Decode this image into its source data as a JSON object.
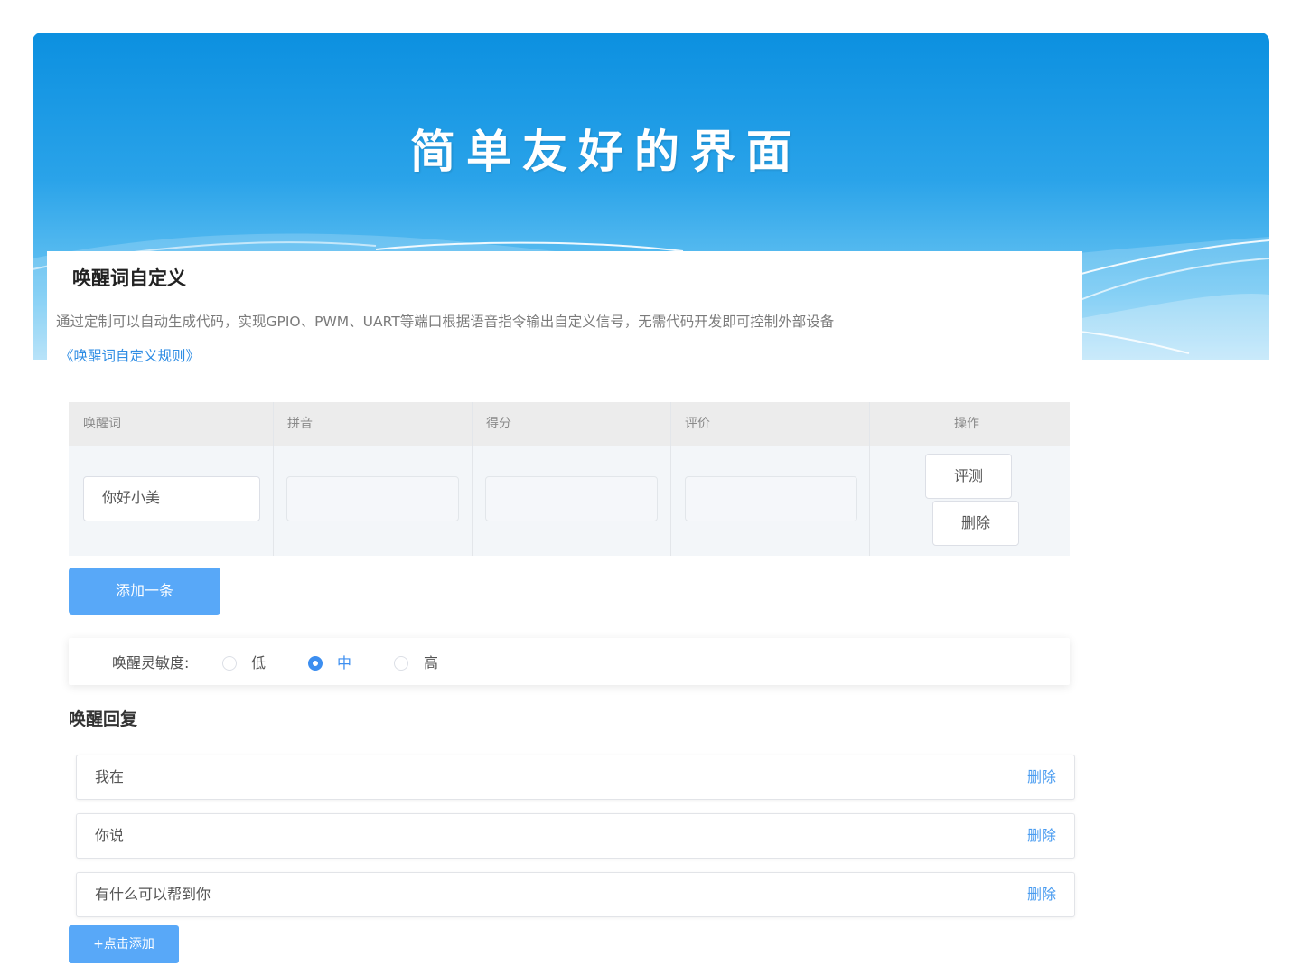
{
  "slide": {
    "title": "简单友好的界面"
  },
  "panel": {
    "title": "唤醒词自定义",
    "description": "通过定制可以自动生成代码，实现GPIO、PWM、UART等端口根据语音指令输出自定义信号，无需代码开发即可控制外部设备",
    "rule_link": "《唤醒词自定义规则》"
  },
  "table": {
    "headers": [
      "唤醒词",
      "拼音",
      "得分",
      "评价",
      "操作"
    ],
    "row": {
      "wake_word": "你好小美",
      "pinyin": "",
      "score": "",
      "evaluation": ""
    },
    "evaluate_label": "评测",
    "delete_label": "删除"
  },
  "add_row_label": "添加一条",
  "sensitivity": {
    "label": "唤醒灵敏度:",
    "options": [
      "低",
      "中",
      "高"
    ],
    "selected": "中"
  },
  "reply": {
    "title": "唤醒回复",
    "items": [
      "我在",
      "你说",
      "有什么可以帮到你"
    ],
    "delete_label": "删除",
    "add_label": "+点击添加"
  },
  "colors": {
    "header_top": "#0c90e0",
    "header_bottom": "#a9ddf8",
    "primary_button": "#58a8f8",
    "link": "#2f8de4",
    "radio_checked": "#3c8ef0"
  }
}
